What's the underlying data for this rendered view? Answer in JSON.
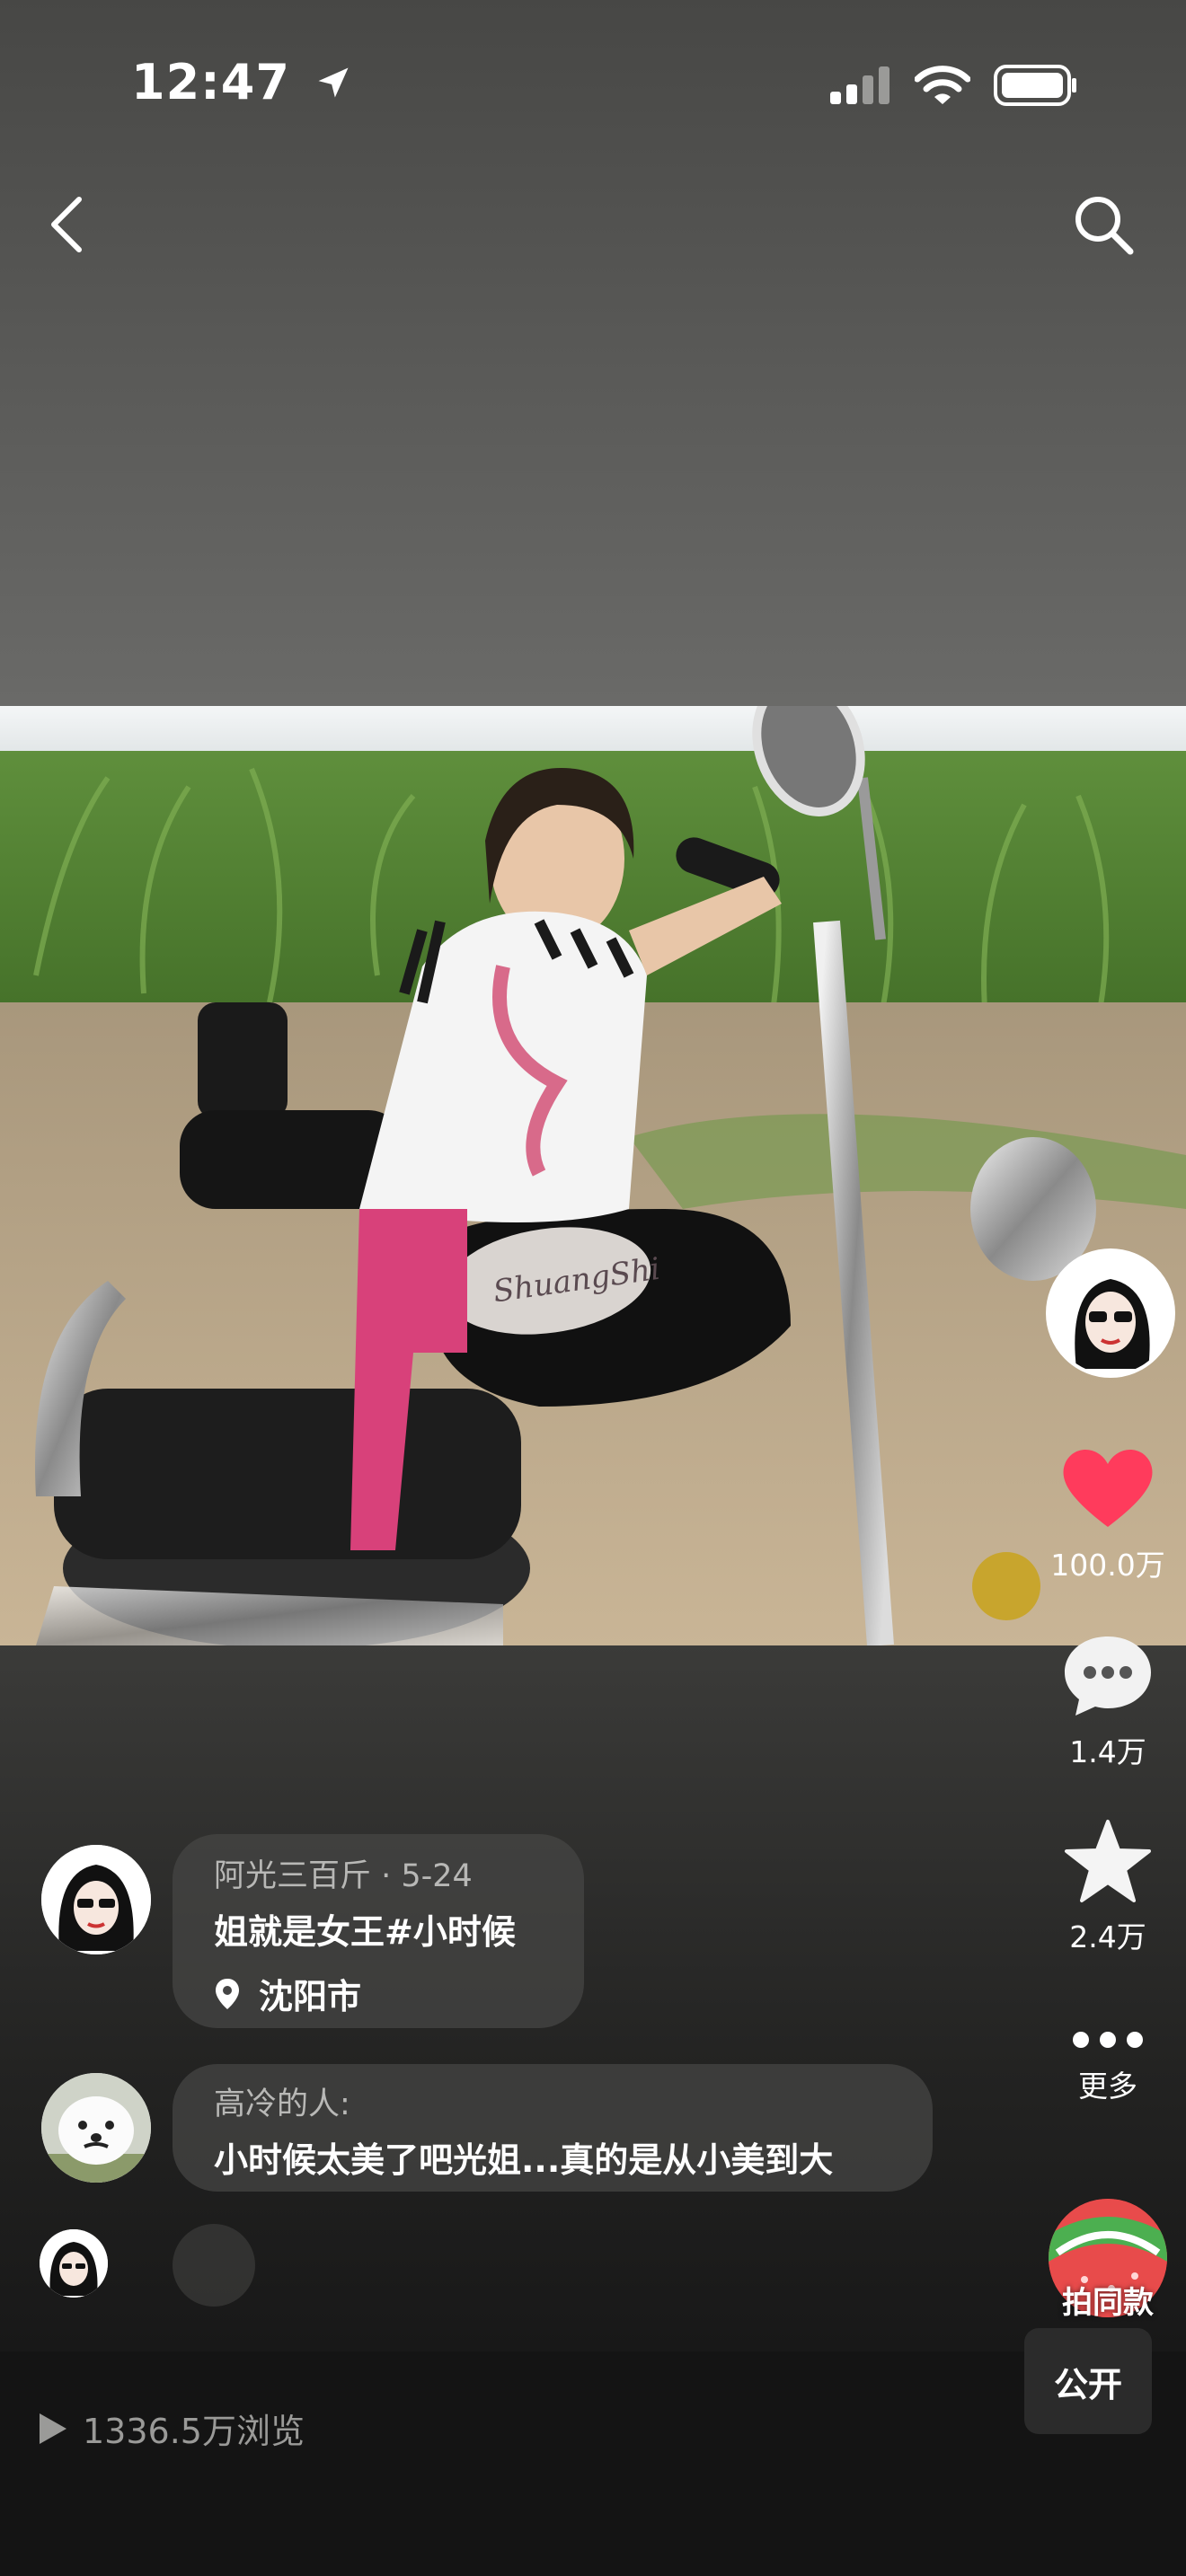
{
  "status_bar": {
    "time": "12:47",
    "icons": [
      "location-arrow-icon",
      "cellular-signal-icon",
      "wifi-icon",
      "battery-icon"
    ]
  },
  "nav": {
    "back_icon": "chevron-left-icon",
    "search_icon": "search-icon"
  },
  "actions": {
    "likes": "100.0万",
    "comments": "1.4万",
    "favorites": "2.4万",
    "more": "更多",
    "remake": "拍同款"
  },
  "post": {
    "author": "阿光三百斤",
    "date": "5-24",
    "meta": "阿光三百斤 · 5-24",
    "caption": "姐就是女王#小时候",
    "location": "沈阳市"
  },
  "comments": [
    {
      "author": "高冷的人:",
      "text": "小时候太美了吧光姐...真的是从小美到大"
    }
  ],
  "footer": {
    "views": "1336.5万浏览",
    "visibility": "公开"
  },
  "colors": {
    "like": "#ff3b5c",
    "bubble": "#464644",
    "footer": "#141414"
  }
}
